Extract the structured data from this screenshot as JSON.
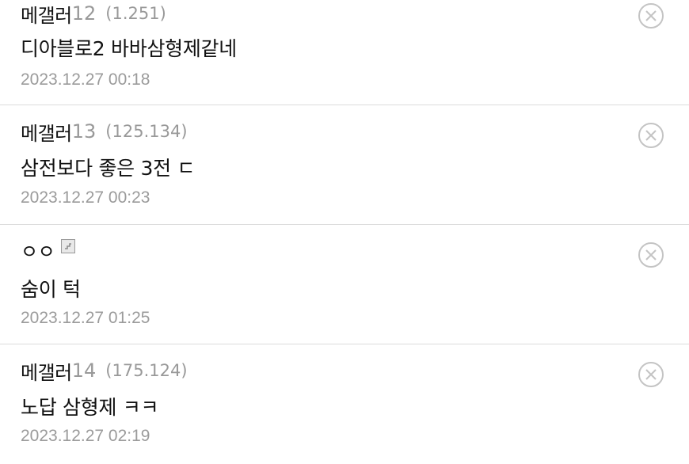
{
  "comments": [
    {
      "nickname": "메갤러",
      "number": "12",
      "ip": "(1.251)",
      "text": "디아블로2 바바삼형제같네",
      "date": "2023.12.27 00:18",
      "delete_icon": "circle-x-icon"
    },
    {
      "nickname": "메갤러",
      "number": "13",
      "ip": "(125.134)",
      "text": "삼전보다 좋은 3전 ㄷ",
      "date": "2023.12.27 00:23",
      "delete_icon": "circle-x-icon"
    },
    {
      "nickname": "ㅇㅇ",
      "badge_icon": "gallercon-icon",
      "text": "숨이 턱",
      "date": "2023.12.27 01:25",
      "delete_icon": "circle-x-icon"
    },
    {
      "nickname": "메갤러",
      "number": "14",
      "ip": "(175.124)",
      "text": "노답 삼형제 ㅋㅋ",
      "date": "2023.12.27 02:19",
      "delete_icon": "circle-x-icon"
    }
  ]
}
